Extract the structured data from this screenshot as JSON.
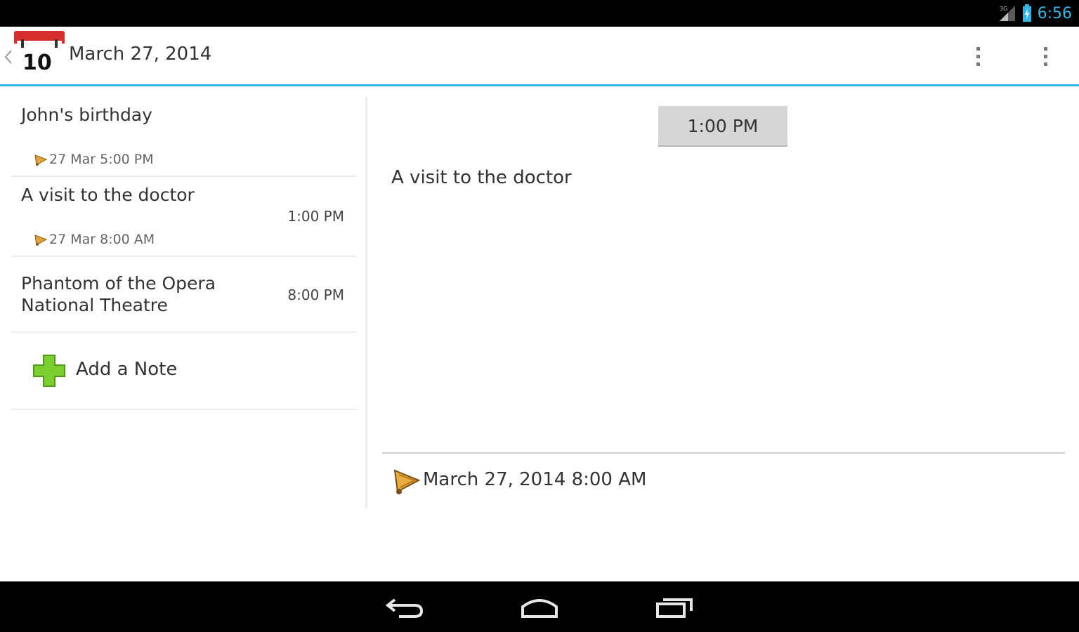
{
  "status_bar": {
    "time": "6:56",
    "signal_icon": "signal-3g-icon",
    "battery_icon": "battery-charging-icon",
    "accent_color": "#33b5e5"
  },
  "header": {
    "app_icon_day": "10",
    "title": "March 27, 2014"
  },
  "notes": [
    {
      "title": "John's birthday",
      "time": "",
      "reminder": "27 Mar 5:00 PM"
    },
    {
      "title": "A visit to the doctor",
      "time": "1:00 PM",
      "reminder": "27 Mar 8:00 AM"
    },
    {
      "title": "Phantom of the Opera",
      "subtitle": "National Theatre",
      "time": "8:00 PM",
      "reminder": ""
    }
  ],
  "add_note_label": "Add a Note",
  "detail": {
    "time_button": "1:00 PM",
    "text": "A visit to the doctor",
    "reminder": "March 27, 2014 8:00 AM"
  }
}
